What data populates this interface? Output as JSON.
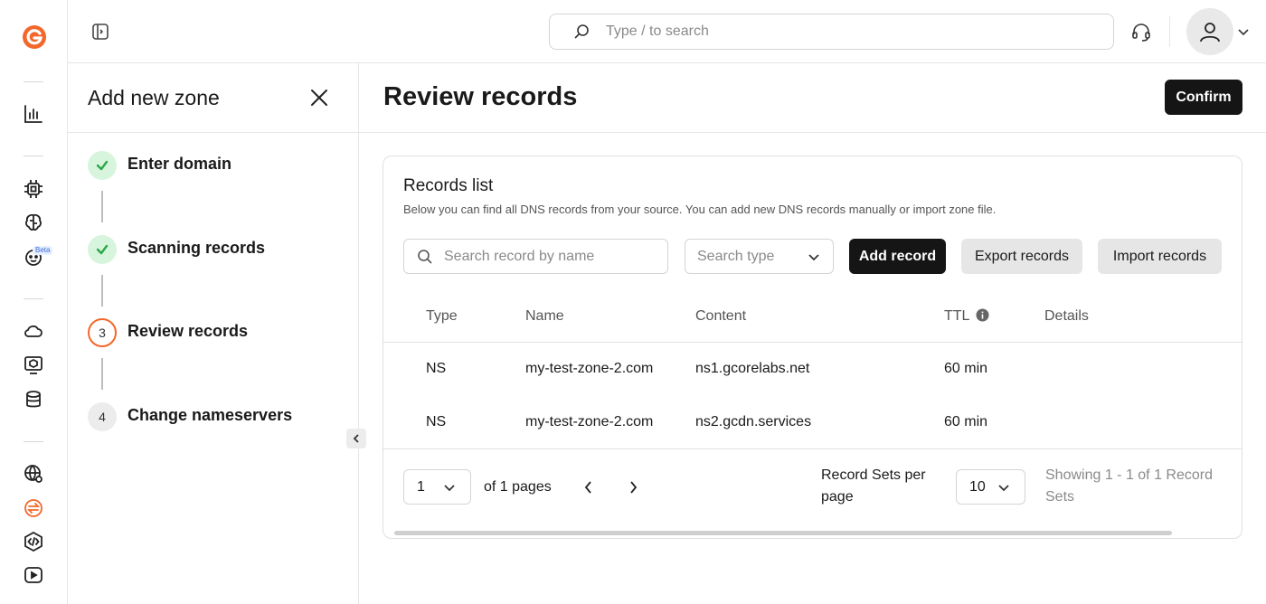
{
  "topbar": {
    "search_placeholder": "Type / to search"
  },
  "rail": {
    "beta_badge": "Beta",
    "icons": [
      "gcore-logo-icon",
      "stats-icon",
      "chip-icon",
      "brain-icon",
      "robot-icon",
      "cloud-icon",
      "cube-monitor-icon",
      "database-icon",
      "globe-gear-icon",
      "transfer-icon",
      "code-icon",
      "video-play-icon"
    ],
    "accent_color": "#f3672a"
  },
  "wizard": {
    "title": "Add new zone",
    "steps": [
      {
        "number": "1",
        "label": "Enter domain",
        "status": "done"
      },
      {
        "number": "2",
        "label": "Scanning records",
        "status": "done"
      },
      {
        "number": "3",
        "label": "Review records",
        "status": "active"
      },
      {
        "number": "4",
        "label": "Change nameservers",
        "status": "pending"
      }
    ]
  },
  "main": {
    "title": "Review records",
    "confirm_label": "Confirm"
  },
  "records": {
    "title": "Records list",
    "description": "Below you can find all DNS records from your source. You can add new DNS records manually or import zone file.",
    "search_placeholder": "Search record by name",
    "type_placeholder": "Search type",
    "add_label": "Add record",
    "export_label": "Export records",
    "import_label": "Import records",
    "columns": [
      "Type",
      "Name",
      "Content",
      "TTL",
      "Details"
    ],
    "rows": [
      {
        "type": "NS",
        "name": "my-test-zone-2.com",
        "content": "ns1.gcorelabs.net",
        "ttl": "60 min",
        "details": ""
      },
      {
        "type": "NS",
        "name": "my-test-zone-2.com",
        "content": "ns2.gcdn.services",
        "ttl": "60 min",
        "details": ""
      }
    ]
  },
  "pagination": {
    "page": "1",
    "of_pages": "of 1 pages",
    "per_page_label": "Record Sets per page",
    "per_page": "10",
    "showing": "Showing 1 - 1 of 1 Record Sets"
  }
}
